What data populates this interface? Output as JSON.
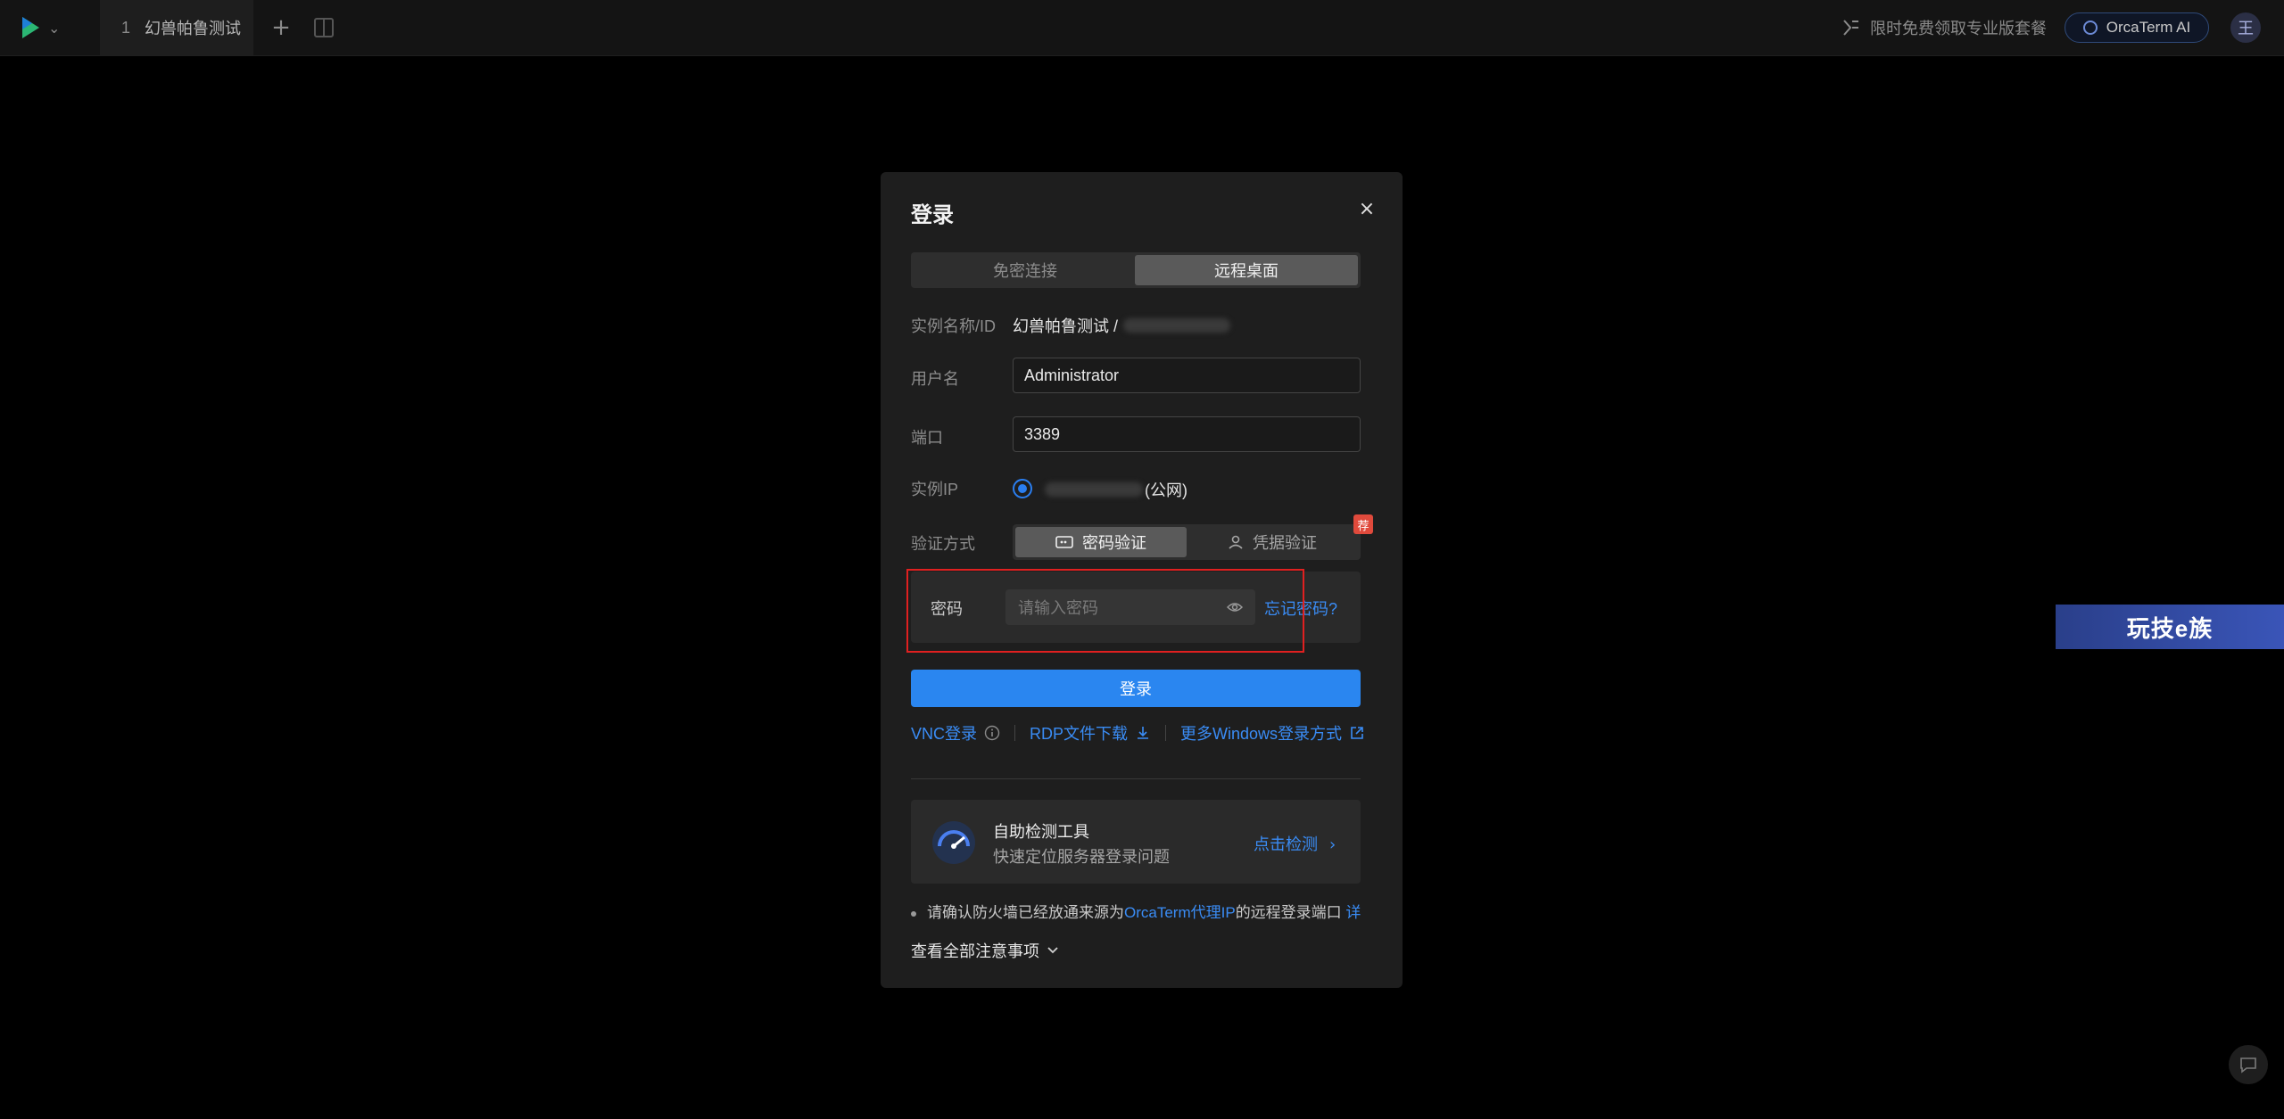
{
  "topbar": {
    "tab_number": "1",
    "tab_label": "幻兽帕鲁测试",
    "promo_text": "限时免费领取专业版套餐",
    "ai_button": "OrcaTerm AI",
    "avatar_initial": "王"
  },
  "modal": {
    "title": "登录",
    "close_label": "×",
    "mode_tabs": [
      "免密连接",
      "远程桌面"
    ],
    "fields": {
      "instance_label": "实例名称/ID",
      "instance_value": "幻兽帕鲁测试 /",
      "username_label": "用户名",
      "username_value": "Administrator",
      "port_label": "端口",
      "port_value": "3389",
      "ip_label": "实例IP",
      "ip_suffix": "(公网)",
      "auth_label": "验证方式",
      "auth_options": [
        "密码验证",
        "凭据验证"
      ],
      "auth_badge": "荐",
      "password_label": "密码",
      "password_placeholder": "请输入密码",
      "forgot_password": "忘记密码?"
    },
    "login_button": "登录",
    "links": {
      "vnc": "VNC登录",
      "rdp": "RDP文件下载",
      "more": "更多Windows登录方式"
    },
    "tool": {
      "title": "自助检测工具",
      "subtitle": "快速定位服务器登录问题",
      "action": "点击检测"
    },
    "note": {
      "prefix": "请确认防火墙已经放通来源为",
      "highlight": "OrcaTerm代理IP",
      "suffix": "的远程登录端口",
      "more": "详"
    },
    "all_notes": "查看全部注意事项"
  },
  "watermark": "玩技e族",
  "colors": {
    "accent": "#2a86f0",
    "link": "#3a8cf5",
    "badge": "#e04a3c",
    "highlight_border": "#e02020"
  }
}
